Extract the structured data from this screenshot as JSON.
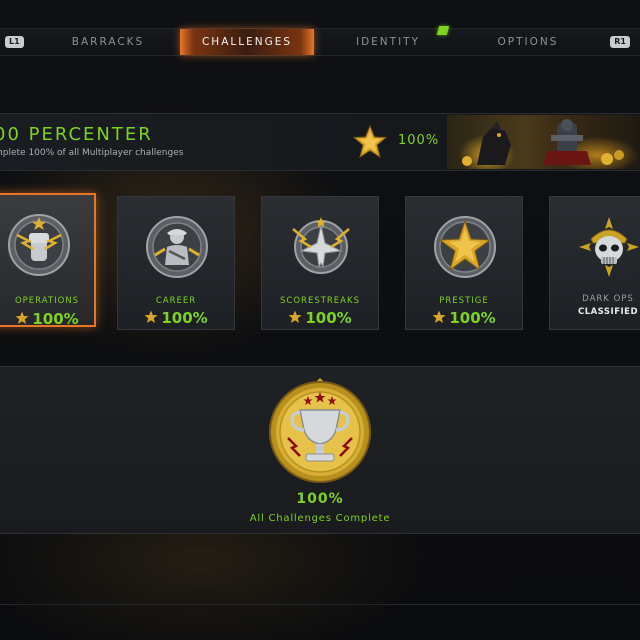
{
  "nav": {
    "left_bumper": "L1",
    "right_bumper": "R1",
    "tabs": [
      {
        "label": "BARRACKS",
        "active": false
      },
      {
        "label": "CHALLENGES",
        "active": true
      },
      {
        "label": "IDENTITY",
        "active": false
      },
      {
        "label": "OPTIONS",
        "active": false
      }
    ]
  },
  "header": {
    "title": "00 PERCENTER",
    "subtitle": "mplete 100% of all Multiplayer challenges",
    "percent": "100%"
  },
  "categories": [
    {
      "label": "OPERATIONS",
      "percent": "100%",
      "selected": true,
      "icon": "fist-lightning-emblem-icon"
    },
    {
      "label": "CAREER",
      "percent": "100%",
      "selected": false,
      "icon": "soldier-emblem-icon"
    },
    {
      "label": "SCORESTREAKS",
      "percent": "100%",
      "selected": false,
      "icon": "jet-lightning-emblem-icon"
    },
    {
      "label": "PRESTIGE",
      "percent": "100%",
      "selected": false,
      "icon": "gold-star-emblem-icon"
    },
    {
      "label": "DARK OPS",
      "status": "CLASSIFIED",
      "selected": false,
      "icon": "skull-emblem-icon"
    }
  ],
  "completion": {
    "percent": "100%",
    "label": "All Challenges Complete",
    "icon": "trophy-medal-icon"
  },
  "colors": {
    "accent_green": "#7ed321",
    "accent_orange": "#e8762a",
    "gold": "#c9a227"
  }
}
